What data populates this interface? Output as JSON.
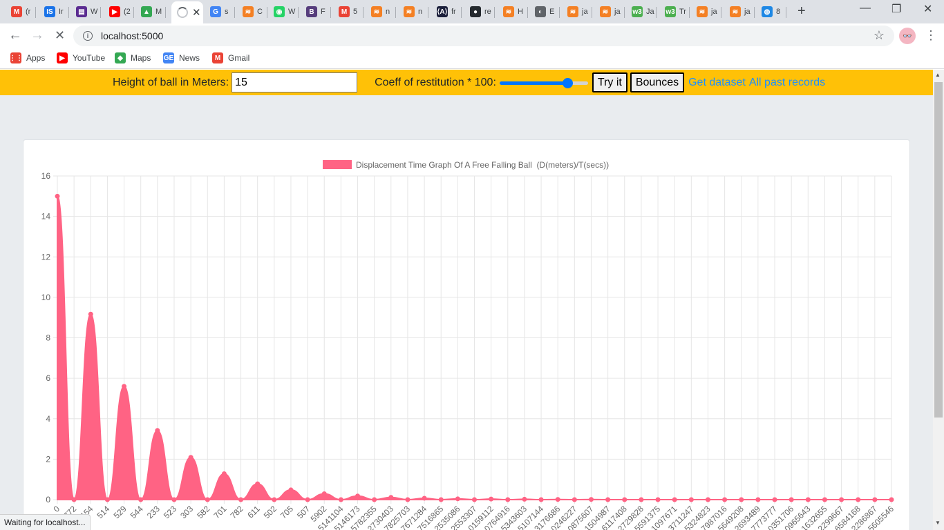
{
  "browser": {
    "tabs": [
      {
        "label": "(r",
        "fav_color": "#ea4335",
        "fav_glyph": "M"
      },
      {
        "label": "Ir",
        "fav_color": "#1a73e8",
        "fav_glyph": "IS"
      },
      {
        "label": "W",
        "fav_color": "#5b2c91",
        "fav_glyph": "▤"
      },
      {
        "label": "(2",
        "fav_color": "#ff0000",
        "fav_glyph": "▶"
      },
      {
        "label": "M",
        "fav_color": "#34a853",
        "fav_glyph": "▲"
      },
      {
        "label": "",
        "fav_color": "#ffffff",
        "fav_glyph": ""
      },
      {
        "label": "s",
        "fav_color": "#4285f4",
        "fav_glyph": "G"
      },
      {
        "label": "C",
        "fav_color": "#f48024",
        "fav_glyph": "≋"
      },
      {
        "label": "W",
        "fav_color": "#25d366",
        "fav_glyph": "◉"
      },
      {
        "label": "F",
        "fav_color": "#563d7c",
        "fav_glyph": "B"
      },
      {
        "label": "5",
        "fav_color": "#ea4335",
        "fav_glyph": "M"
      },
      {
        "label": "n",
        "fav_color": "#f48024",
        "fav_glyph": "≋"
      },
      {
        "label": "n",
        "fav_color": "#f48024",
        "fav_glyph": "≋"
      },
      {
        "label": "fr",
        "fav_color": "#1b1f3b",
        "fav_glyph": "⟨A⟩"
      },
      {
        "label": "re",
        "fav_color": "#24292e",
        "fav_glyph": "●"
      },
      {
        "label": "H",
        "fav_color": "#f48024",
        "fav_glyph": "≋"
      },
      {
        "label": "E",
        "fav_color": "#5f6368",
        "fav_glyph": "◐"
      },
      {
        "label": "ja",
        "fav_color": "#f48024",
        "fav_glyph": "≋"
      },
      {
        "label": "ja",
        "fav_color": "#f48024",
        "fav_glyph": "≋"
      },
      {
        "label": "Ja",
        "fav_color": "#4caf50",
        "fav_glyph": "w3"
      },
      {
        "label": "Tr",
        "fav_color": "#4caf50",
        "fav_glyph": "w3"
      },
      {
        "label": "ja",
        "fav_color": "#f48024",
        "fav_glyph": "≋"
      },
      {
        "label": "ja",
        "fav_color": "#f48024",
        "fav_glyph": "≋"
      },
      {
        "label": "8",
        "fav_color": "#1e88e5",
        "fav_glyph": "◍"
      }
    ],
    "active_tab_index": 5,
    "new_tab_glyph": "+",
    "window_controls": {
      "minimize": "—",
      "restore": "❐",
      "close": "✕"
    },
    "nav": {
      "back": "←",
      "forward": "→",
      "reload": "✕"
    },
    "address": "localhost:5000",
    "info_glyph": "i",
    "star_glyph": "☆",
    "avatar_glyph": "👓",
    "menu_glyph": "⋮",
    "bookmarks": [
      {
        "label": "Apps",
        "icon": "apps-icon",
        "color": "#ea4335",
        "glyph": "⋮⋮"
      },
      {
        "label": "YouTube",
        "icon": "youtube-icon",
        "color": "#ff0000",
        "glyph": "▶"
      },
      {
        "label": "Maps",
        "icon": "maps-icon",
        "color": "#34a853",
        "glyph": "◆"
      },
      {
        "label": "News",
        "icon": "news-icon",
        "color": "#4285f4",
        "glyph": "GE"
      },
      {
        "label": "Gmail",
        "icon": "gmail-icon",
        "color": "#ea4335",
        "glyph": "M"
      }
    ],
    "status_text": "Waiting for localhost..."
  },
  "controls": {
    "height_label": "Height of ball in Meters:",
    "height_value": "15",
    "coeff_label": "Coeff of restitution * 100:",
    "coeff_value": 77,
    "coeff_min": 0,
    "coeff_max": 100,
    "try_label": "Try it",
    "bounces_label": "Bounces",
    "dataset_link": "Get dataset",
    "records_link": "All past records",
    "bar_color": "#ffc107",
    "link_color": "#1e90ff"
  },
  "chart_data": {
    "type": "area",
    "legend": "Displacement Time Graph Of A Free Falling Ball  (D(meters)/T(secs))",
    "legend_position": "top",
    "color": "#ff6384",
    "ylim": [
      0,
      16
    ],
    "yticks": [
      0,
      2,
      4,
      6,
      8,
      10,
      12,
      14,
      16
    ],
    "grid": true,
    "x": [
      "0",
      "772",
      "154",
      "514",
      "529",
      "544",
      "233",
      "523",
      "303",
      "582",
      "701",
      "782",
      "611",
      "502",
      "705",
      "507",
      "5902",
      "5141104",
      "5146173",
      "5782355",
      "2730403",
      "7825703",
      "7671284",
      "7516865",
      "2535086",
      "2553307",
      "0159112",
      "0764916",
      "5343603",
      "5107144",
      "3176686",
      "0246227",
      "0875607",
      "1504987",
      "6117408",
      "2729828",
      "5591375",
      "1097671",
      "3711247",
      "5324823",
      "7987016",
      "5649208",
      "2693489",
      "7773777",
      "0351706",
      "0965643",
      "1632655",
      "2299667",
      "6584168",
      "2286867",
      "5605546"
    ],
    "y": [
      15.0,
      0.0,
      9.17,
      0.0,
      5.6,
      0.0,
      3.42,
      0.0,
      2.09,
      0.0,
      1.28,
      0.0,
      0.78,
      0.0,
      0.48,
      0.0,
      0.29,
      0.0,
      0.18,
      0.0,
      0.11,
      0.0,
      0.07,
      0.0,
      0.04,
      0.0,
      0.03,
      0.0,
      0.02,
      0.0,
      0.01,
      0.0,
      0.01,
      0.0,
      0.0,
      0.0,
      0.0,
      0.0,
      0.0,
      0.0,
      0.0,
      0.0,
      0.0,
      0.0,
      0.0,
      0.0,
      0.0,
      0.0,
      0.0,
      0.0,
      0.0
    ]
  }
}
